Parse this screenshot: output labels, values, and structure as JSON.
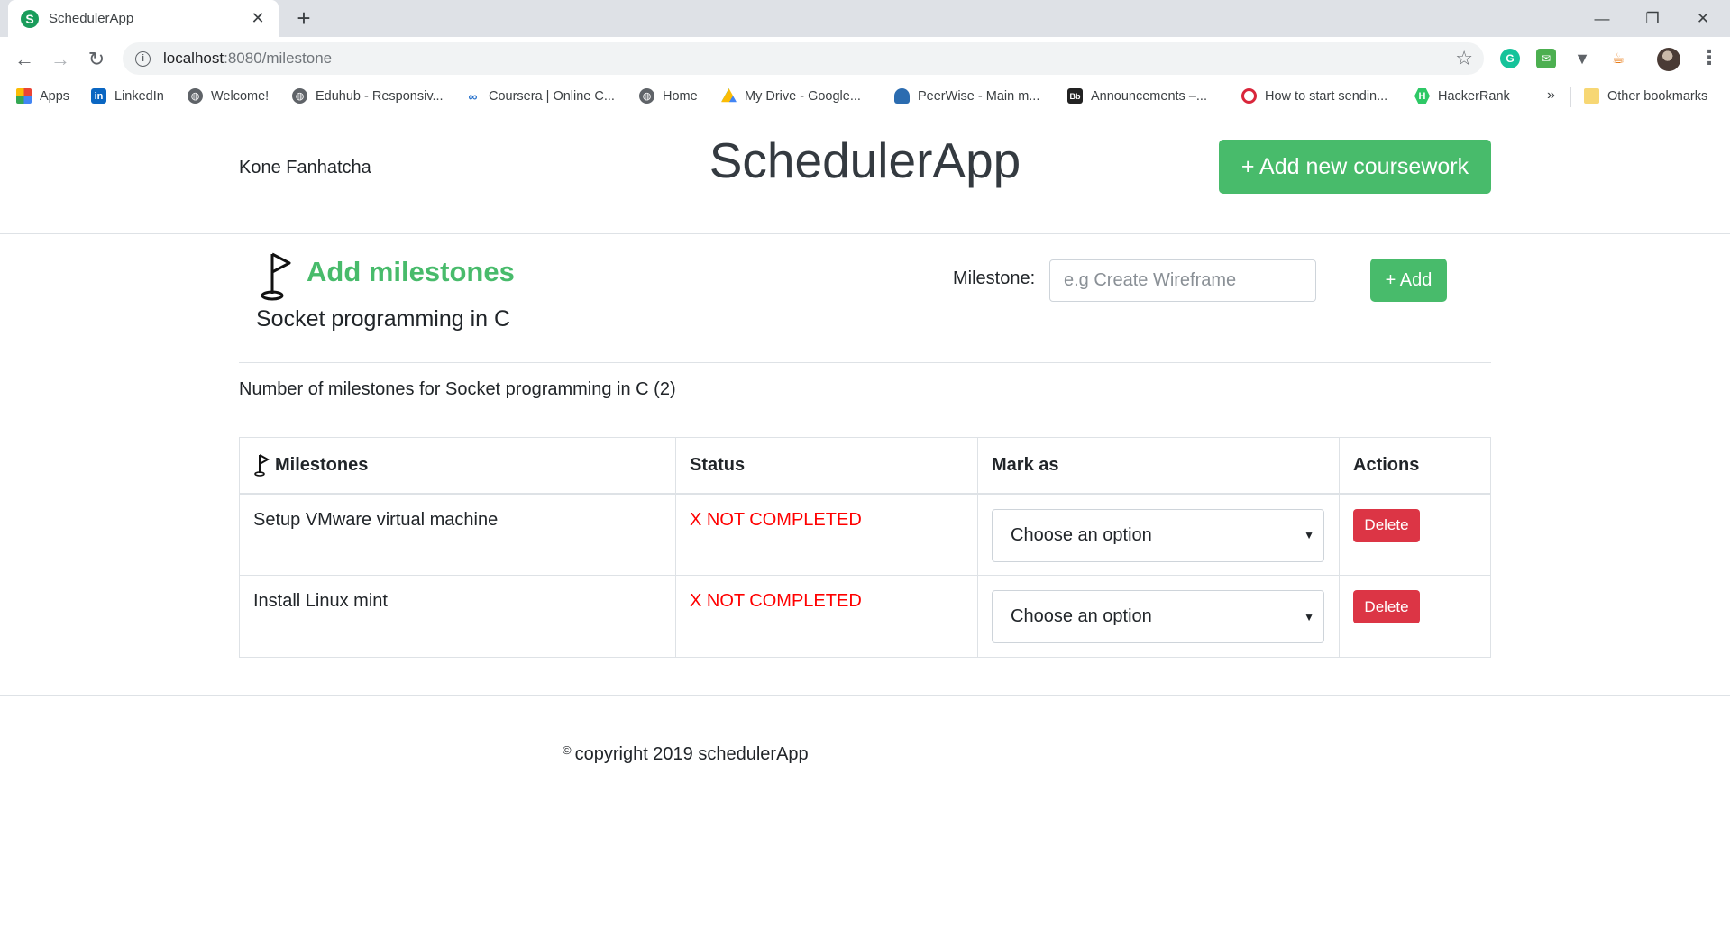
{
  "browser": {
    "tab_title": "SchedulerApp",
    "tab_favicon": "S",
    "url_host": "localhost",
    "url_path": ":8080/milestone",
    "bookmarks": [
      {
        "label": "Apps",
        "icon": "apps-grid-icon"
      },
      {
        "label": "LinkedIn",
        "icon": "linkedin-icon"
      },
      {
        "label": "Welcome!",
        "icon": "globe-icon"
      },
      {
        "label": "Eduhub - Responsiv...",
        "icon": "globe-icon"
      },
      {
        "label": "Coursera | Online C...",
        "icon": "coursera-icon"
      },
      {
        "label": "Home",
        "icon": "globe-icon"
      },
      {
        "label": "My Drive - Google...",
        "icon": "google-drive-icon"
      },
      {
        "label": "PeerWise - Main m...",
        "icon": "peerwise-icon"
      },
      {
        "label": "Announcements –...",
        "icon": "blackboard-icon"
      },
      {
        "label": "How to start sendin...",
        "icon": "target-icon"
      },
      {
        "label": "HackerRank",
        "icon": "hackerrank-icon"
      }
    ],
    "overflow_label": "»",
    "other_bookmarks": "Other bookmarks"
  },
  "header": {
    "user_name": "Kone Fanhatcha",
    "brand": "SchedulerApp",
    "add_coursework_label": "+ Add new coursework"
  },
  "add_section": {
    "title": "Add milestones",
    "course": "Socket programming in C",
    "milestone_label": "Milestone:",
    "milestone_placeholder": "e.g Create Wireframe",
    "add_label": "+ Add"
  },
  "count_text": "Number of milestones for Socket programming in C (2)",
  "table": {
    "headers": [
      "Milestones",
      "Status",
      "Mark as",
      "Actions"
    ],
    "rows": [
      {
        "milestone": "Setup VMware virtual machine",
        "status": "X NOT COMPLETED",
        "mark_as": "Choose an option",
        "action": "Delete"
      },
      {
        "milestone": "Install Linux mint",
        "status": "X NOT COMPLETED",
        "mark_as": "Choose an option",
        "action": "Delete"
      }
    ]
  },
  "footer": {
    "copyright_symbol": "©",
    "text": "copyright 2019 schedulerApp"
  },
  "colors": {
    "accent_green": "#48bb6b",
    "danger_red": "#dc3545",
    "status_red": "#ff0000"
  }
}
